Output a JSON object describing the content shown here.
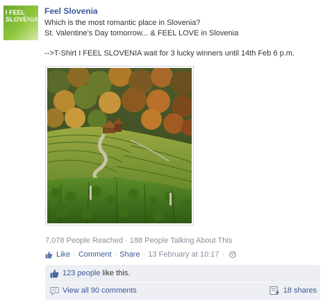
{
  "post": {
    "page_name": "Feel Slovenia",
    "avatar_line1": "I FEEL",
    "avatar_line2_bold": "SLOVE",
    "avatar_line2_rest": "NIA",
    "lines": [
      "Which is the most romantic place in Slovenia?",
      "St. Valentine’s Day tomorrow... & FEEL LOVE in Slovenia",
      "-->T-Shirt I FEEL SLOVENIA wait for 3 lucky winners until 14th Feb 6 p.m."
    ],
    "stats": "7,078 People Reached · 188 People Talking About This",
    "actions": {
      "like": "Like",
      "comment": "Comment",
      "share": "Share",
      "timestamp": "13 February at 10:17"
    },
    "likes": {
      "count_link": "123 people",
      "suffix": " like this."
    },
    "comments": {
      "view_all": "View all 90 comments",
      "shares": "18 shares"
    }
  },
  "colors": {
    "link": "#3b5998",
    "muted": "#898f9c",
    "panel": "#edeff4",
    "brand_green": "#7bb532"
  },
  "icons": [
    "like-icon",
    "globe-icon",
    "thumbs-up-icon",
    "comment-icon",
    "share-icon"
  ]
}
